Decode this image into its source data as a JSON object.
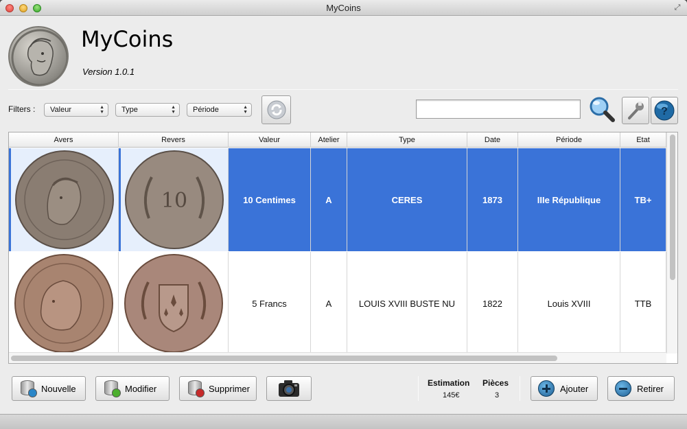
{
  "window": {
    "title": "MyCoins"
  },
  "app": {
    "name": "MyCoins",
    "version": "Version 1.0.1"
  },
  "filters": {
    "label": "Filters :",
    "valeur": "Valeur",
    "type": "Type",
    "periode": "Période"
  },
  "search": {
    "value": "",
    "placeholder": ""
  },
  "table": {
    "columns": [
      "Avers",
      "Revers",
      "Valeur",
      "Atelier",
      "Type",
      "Date",
      "Période",
      "Etat"
    ],
    "rows": [
      {
        "valeur": "10 Centimes",
        "atelier": "A",
        "type": "CERES",
        "date": "1873",
        "periode": "IIIe République",
        "etat": "TB+",
        "selected": true
      },
      {
        "valeur": "5 Francs",
        "atelier": "A",
        "type": "LOUIS XVIII BUSTE NU",
        "date": "1822",
        "periode": "Louis XVIII",
        "etat": "TTB",
        "selected": false
      }
    ]
  },
  "actions": {
    "nouvelle": "Nouvelle",
    "modifier": "Modifier",
    "supprimer": "Supprimer",
    "ajouter": "Ajouter",
    "retirer": "Retirer"
  },
  "stats": {
    "estimation_label": "Estimation",
    "pieces_label": "Pièces",
    "estimation_value": "145€",
    "pieces_value": "3"
  },
  "colors": {
    "selection": "#3a73d8",
    "window_bg": "#ececec"
  }
}
